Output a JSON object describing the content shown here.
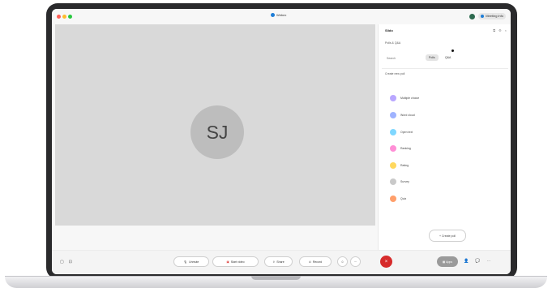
{
  "window": {
    "title": "Webex"
  },
  "header_right": {
    "meeting_info_label": "Meeting info"
  },
  "video": {
    "participant_initials": "SJ"
  },
  "panel": {
    "title": "Slido",
    "subtitle": "Polls & Q&A",
    "search_placeholder": "Search",
    "segments": [
      "Polls",
      "Q&A"
    ],
    "section_title": "Create new poll",
    "options": [
      {
        "label": "Multiple choice",
        "color": "#b9a7ff"
      },
      {
        "label": "Word cloud",
        "color": "#9fb3ff"
      },
      {
        "label": "Open text",
        "color": "#7fd7ff"
      },
      {
        "label": "Ranking",
        "color": "#ff8fd6"
      },
      {
        "label": "Rating",
        "color": "#ffd85e"
      },
      {
        "label": "Survey",
        "color": "#c9c9c9"
      },
      {
        "label": "Quiz",
        "color": "#ff9f6b"
      }
    ],
    "create_button": "+ Create poll"
  },
  "toolbar": {
    "unmute_label": "Unmute",
    "start_video_label": "Start video",
    "share_label": "Share",
    "record_label": "Record",
    "apps_label": "Apps",
    "end_icon": "close-icon"
  }
}
